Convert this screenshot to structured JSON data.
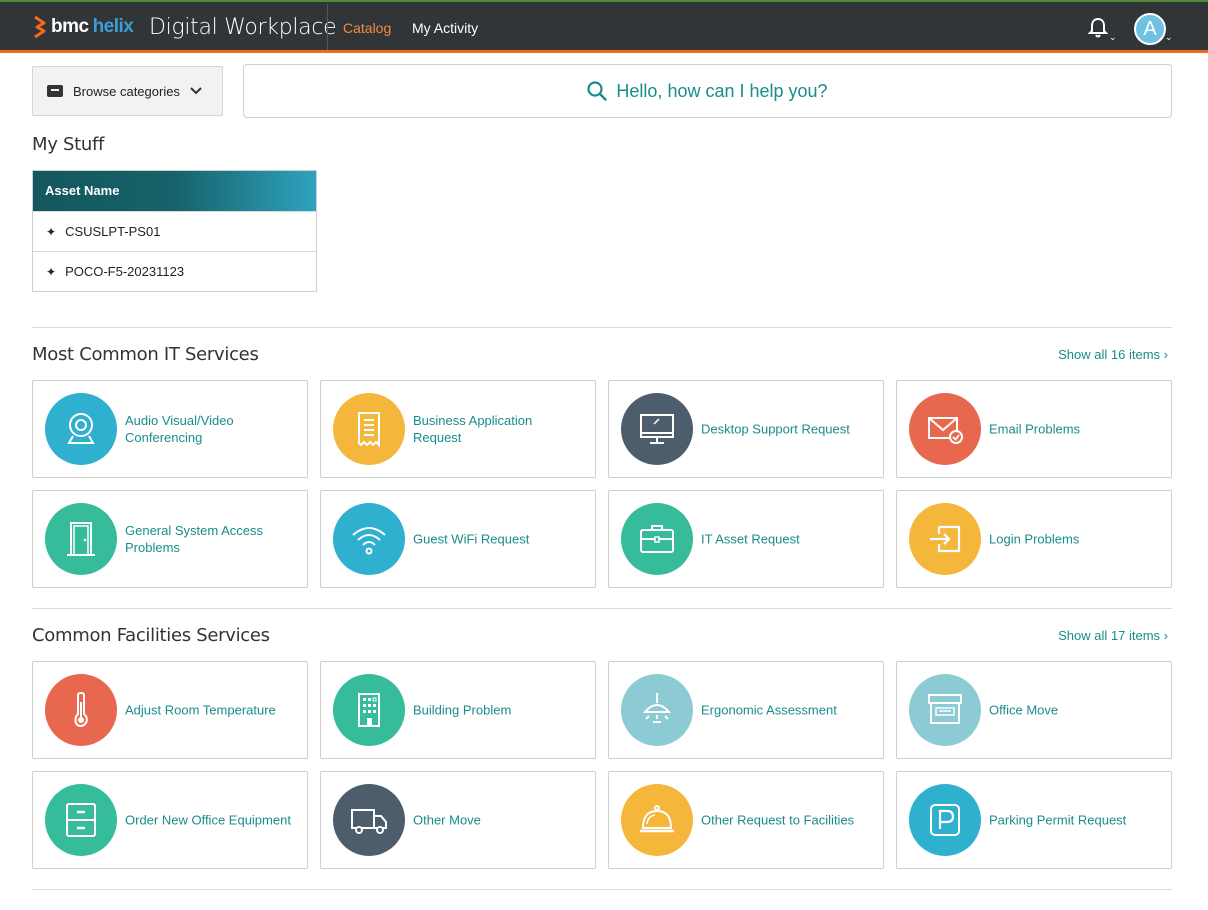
{
  "header": {
    "logo_bmc": "bmc",
    "logo_helix": "helix",
    "app_title": "Digital Workplace",
    "nav": [
      {
        "label": "Catalog",
        "active": true
      },
      {
        "label": "My Activity",
        "active": false
      }
    ],
    "avatar_initial": "A",
    "colors": {
      "bar": "#313538",
      "accent": "#f06b1b",
      "active_nav": "#f58a3c"
    }
  },
  "browse": {
    "label": "Browse categories",
    "icon": "inbox-icon"
  },
  "search": {
    "placeholder": "Hello, how can I help you?",
    "icon": "search-icon"
  },
  "my_stuff": {
    "title": "My Stuff",
    "column": "Asset Name",
    "rows": [
      "CSUSLPT-PS01",
      "POCO-F5-20231123"
    ]
  },
  "it_services": {
    "title": "Most Common IT Services",
    "show_all": "Show all 16 items",
    "items": [
      {
        "label": "Audio Visual/Video Conferencing",
        "icon": "webcam-icon",
        "color": "#2fb0cf"
      },
      {
        "label": "Business Application Request",
        "icon": "receipt-icon",
        "color": "#f5b63c"
      },
      {
        "label": "Desktop Support Request",
        "icon": "monitor-icon",
        "color": "#4d5d6b"
      },
      {
        "label": "Email Problems",
        "icon": "email-icon",
        "color": "#e8684f"
      },
      {
        "label": "General System Access Problems",
        "icon": "door-icon",
        "color": "#36bc9b"
      },
      {
        "label": "Guest WiFi Request",
        "icon": "wifi-icon",
        "color": "#2fb0cf"
      },
      {
        "label": "IT Asset Request",
        "icon": "briefcase-icon",
        "color": "#36bc9b"
      },
      {
        "label": "Login Problems",
        "icon": "login-icon",
        "color": "#f5b63c"
      }
    ]
  },
  "facilities_services": {
    "title": "Common Facilities Services",
    "show_all": "Show all 17 items",
    "items": [
      {
        "label": "Adjust Room Temperature",
        "icon": "thermometer-icon",
        "color": "#e8684f"
      },
      {
        "label": "Building Problem",
        "icon": "building-icon",
        "color": "#36bc9b"
      },
      {
        "label": "Ergonomic Assessment",
        "icon": "lamp-icon",
        "color": "#8ccbd3"
      },
      {
        "label": "Office Move",
        "icon": "box-icon",
        "color": "#8ccbd3"
      },
      {
        "label": "Order New Office Equipment",
        "icon": "cabinet-icon",
        "color": "#36bc9b"
      },
      {
        "label": "Other Move",
        "icon": "truck-icon",
        "color": "#4d5d6b"
      },
      {
        "label": "Other Request to Facilities",
        "icon": "service-bell-icon",
        "color": "#f5b63c"
      },
      {
        "label": "Parking Permit Request",
        "icon": "parking-icon",
        "color": "#2fb0cf"
      }
    ]
  }
}
